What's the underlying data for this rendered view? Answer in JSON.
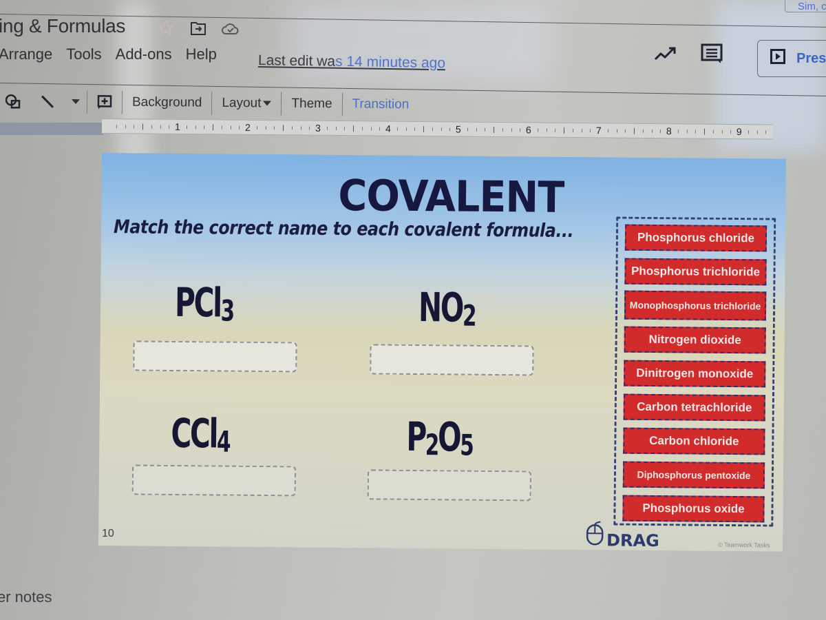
{
  "app": {
    "account_chip": "Sim, c",
    "doc_title": "ing & Formulas",
    "title_icons": [
      "star-icon",
      "move-to-folder-icon",
      "cloud-saved-icon"
    ]
  },
  "menubar": {
    "items": [
      "Arrange",
      "Tools",
      "Add-ons",
      "Help"
    ],
    "last_edit_prefix": "Last edit wa",
    "last_edit_suffix": "s 14 minutes ago"
  },
  "header_right": {
    "icons": [
      "activity-trend-icon",
      "comments-icon"
    ],
    "present_label": "Pres"
  },
  "toolbar": {
    "background_label": "Background",
    "layout_label": "Layout",
    "theme_label": "Theme",
    "transition_label": "Transition"
  },
  "ruler": {
    "marks": [
      "1",
      "2",
      "3",
      "4",
      "5",
      "6",
      "7",
      "8",
      "9"
    ]
  },
  "slide": {
    "title": "COVALENT",
    "subtitle": "Match the correct name to each covalent formula...",
    "formulas": [
      {
        "base": "PCl",
        "sub": "3",
        "plain": "PCl3"
      },
      {
        "base": "NO",
        "sub": "2",
        "plain": "NO2"
      },
      {
        "base": "CCl",
        "sub": "4",
        "plain": "CCl4"
      },
      {
        "base": "P",
        "sub": "2",
        "mid": "O",
        "sub2": "5",
        "plain": "P2O5"
      }
    ],
    "answer_bank": [
      "Phosphorus chloride",
      "Phosphorus trichloride",
      "Monophosphorus trichloride",
      "Nitrogen dioxide",
      "Dinitrogen monoxide",
      "Carbon tetrachloride",
      "Carbon chloride",
      "Diphosphorus pentoxide",
      "Phosphorus oxide"
    ],
    "drag_label": "DRAG",
    "credit": "© Teamwork Tasks",
    "chip_color": "#d22b2b",
    "title_color": "#16183f"
  },
  "footer": {
    "slide_number": "10",
    "notes_label": "er notes"
  }
}
